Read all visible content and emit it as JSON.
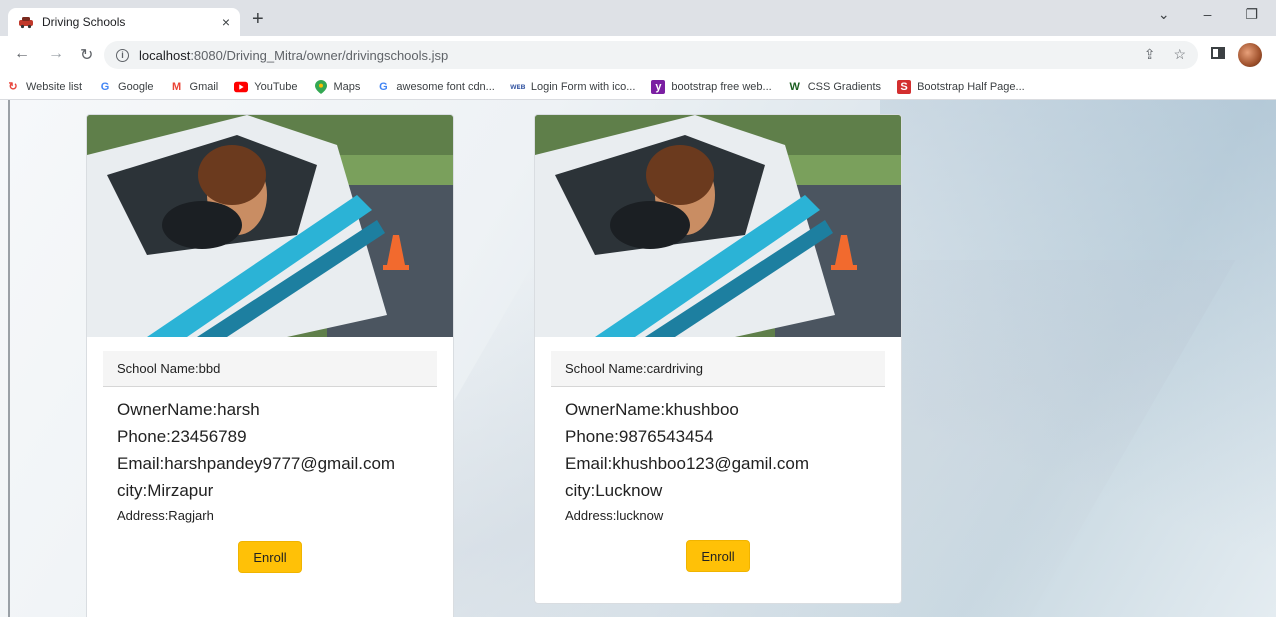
{
  "browser": {
    "tab_title": "Driving Schools",
    "tab_close": "×",
    "new_tab": "+",
    "url_host": "localhost",
    "url_rest": ":8080/Driving_Mitra/owner/drivingschools.jsp",
    "window_controls": [
      "⌄",
      "–",
      "❐"
    ],
    "bookmarks": [
      {
        "label": "Website list",
        "icon": "website-list-icon",
        "color": "#e8453c"
      },
      {
        "label": "Google",
        "icon": "google-icon",
        "color": "#4285f4"
      },
      {
        "label": "Gmail",
        "icon": "gmail-icon",
        "color": "#ea4335"
      },
      {
        "label": "YouTube",
        "icon": "youtube-icon",
        "color": "#ff0000"
      },
      {
        "label": "Maps",
        "icon": "maps-icon",
        "color": "#34a853"
      },
      {
        "label": "awesome font cdn...",
        "icon": "google-icon",
        "color": "#4285f4"
      },
      {
        "label": "Login Form with ico...",
        "icon": "w3-icon",
        "color": "#3b5ba5"
      },
      {
        "label": "bootstrap free web...",
        "icon": "yahoo-icon",
        "color": "#7b1fa2"
      },
      {
        "label": "CSS Gradients",
        "icon": "w-icon",
        "color": "#1b5e20"
      },
      {
        "label": "Bootstrap Half Page...",
        "icon": "s-icon",
        "color": "#d32f2f"
      }
    ]
  },
  "schools": [
    {
      "school_name": "School Name:bbd",
      "owner": "OwnerName:harsh",
      "phone": "Phone:23456789",
      "email": "Email:harshpandey9777@gmail.com",
      "city": "city:Mirzapur",
      "address": "Address:Ragjarh",
      "button": "Enroll"
    },
    {
      "school_name": "School Name:cardriving",
      "owner": "OwnerName:khushboo",
      "phone": "Phone:9876543454",
      "email": "Email:khushboo123@gamil.com",
      "city": "city:Lucknow",
      "address": "Address:lucknow",
      "button": "Enroll"
    }
  ]
}
